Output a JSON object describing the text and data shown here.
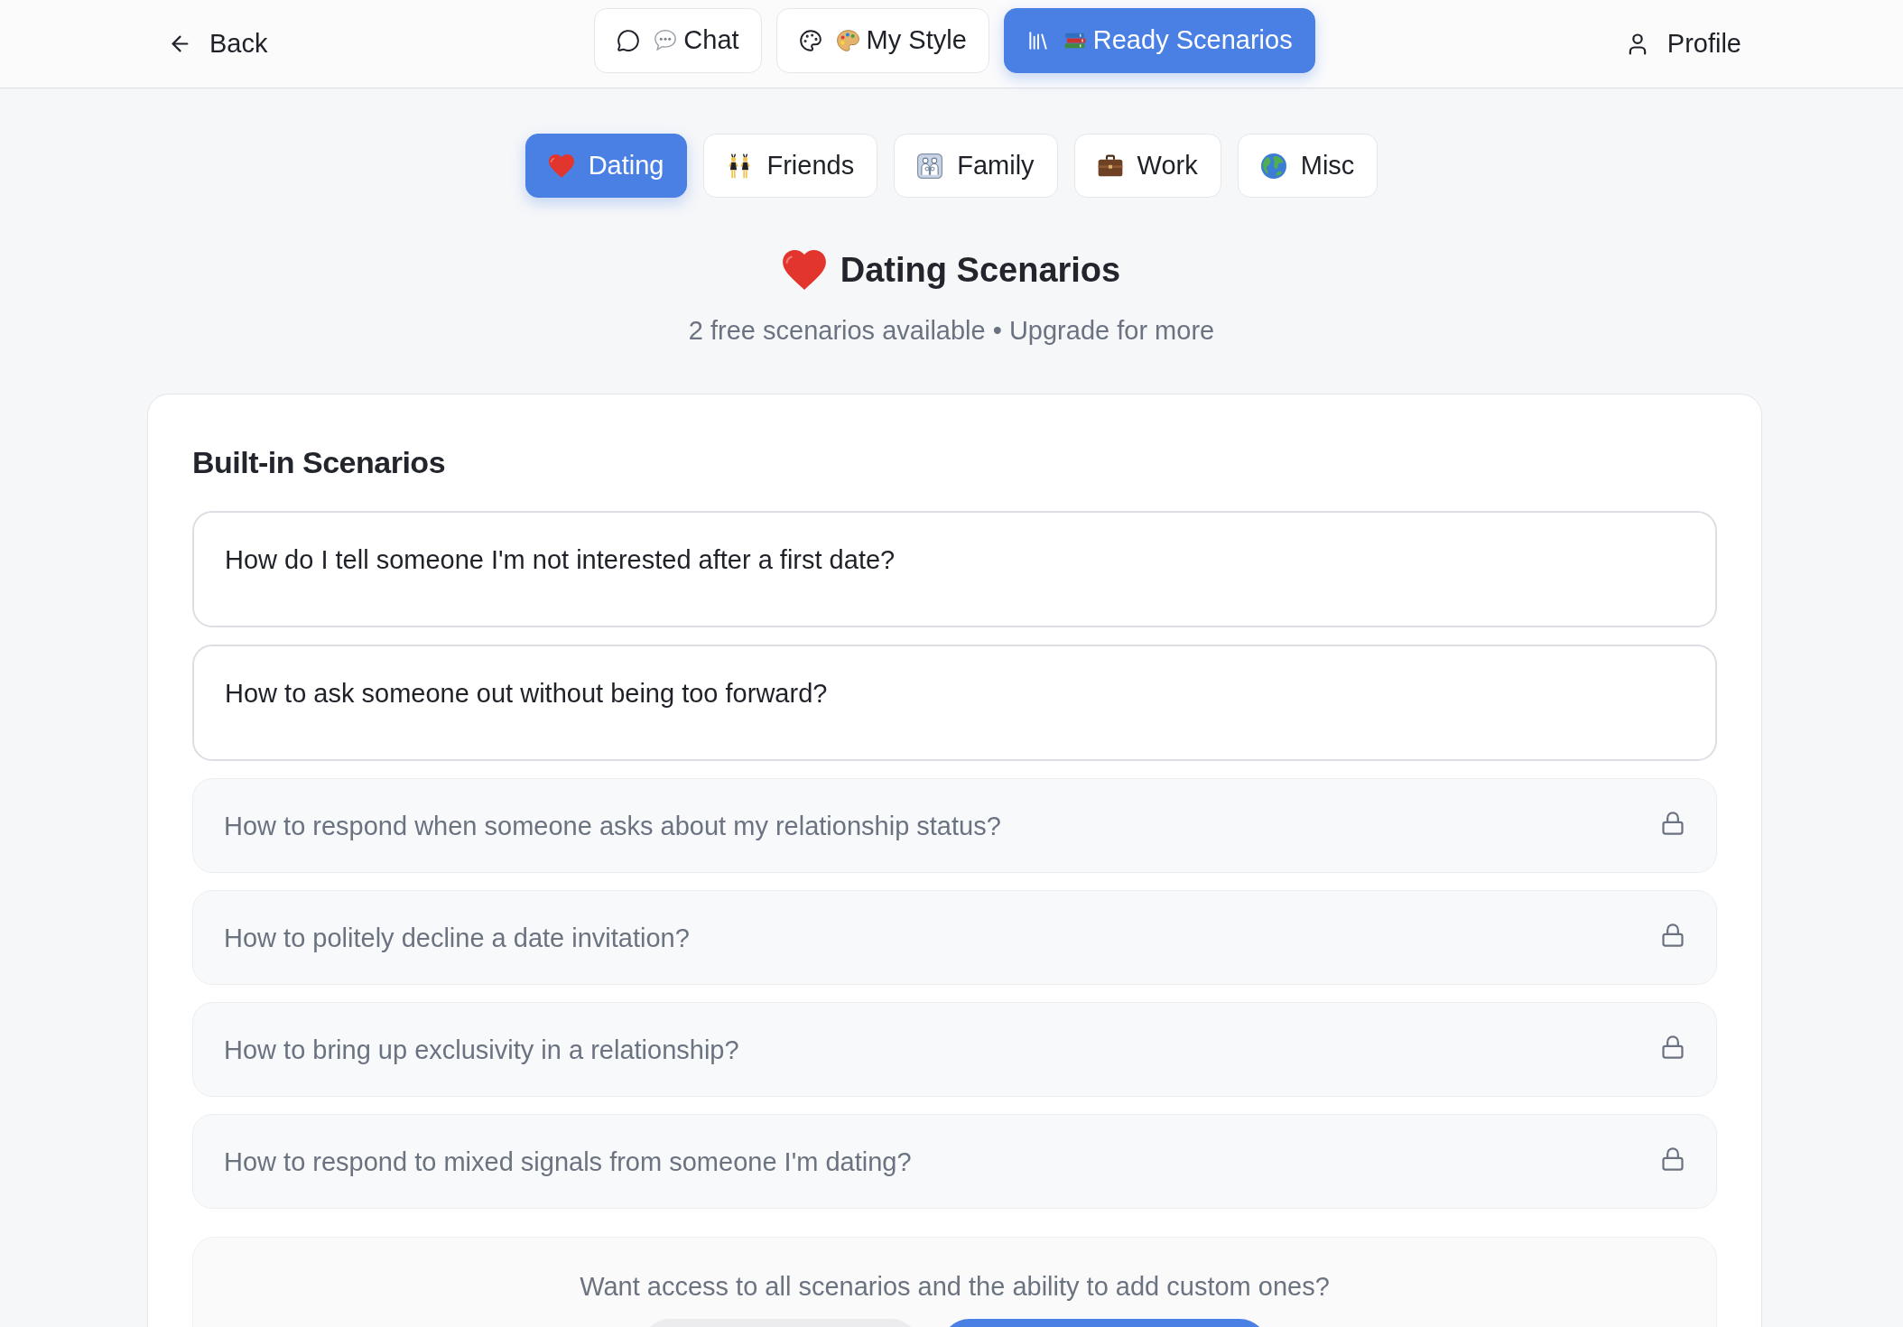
{
  "nav": {
    "back": "Back",
    "tabs": [
      {
        "label": "Chat",
        "kind": "chat",
        "selected": false
      },
      {
        "label": "My Style",
        "kind": "style",
        "selected": false
      },
      {
        "label": "Ready Scenarios",
        "kind": "scenarios",
        "selected": true
      }
    ],
    "profile": "Profile"
  },
  "categories": [
    {
      "label": "Dating",
      "kind": "heart",
      "selected": true
    },
    {
      "label": "Friends",
      "kind": "dancers",
      "selected": false
    },
    {
      "label": "Family",
      "kind": "family",
      "selected": false
    },
    {
      "label": "Work",
      "kind": "briefcase",
      "selected": false
    },
    {
      "label": "Misc",
      "kind": "globe",
      "selected": false
    }
  ],
  "heading": {
    "title": "Dating Scenarios",
    "subtitle": "2 free scenarios available • Upgrade for more"
  },
  "builtin": {
    "title": "Built-in Scenarios",
    "scenarios": [
      {
        "text": "How do I tell someone I'm not interested after a first date?",
        "locked": false
      },
      {
        "text": "How to ask someone out without being too forward?",
        "locked": false
      },
      {
        "text": "How to respond when someone asks about my relationship status?",
        "locked": true
      },
      {
        "text": "How to politely decline a date invitation?",
        "locked": true
      },
      {
        "text": "How to bring up exclusivity in a relationship?",
        "locked": true
      },
      {
        "text": "How to respond to mixed signals from someone I'm dating?",
        "locked": true
      }
    ]
  },
  "upgrade": {
    "prompt": "Want access to all scenarios and the ability to add custom ones?",
    "buttons": [
      {
        "kind": "secondary"
      },
      {
        "kind": "primary"
      }
    ]
  }
}
